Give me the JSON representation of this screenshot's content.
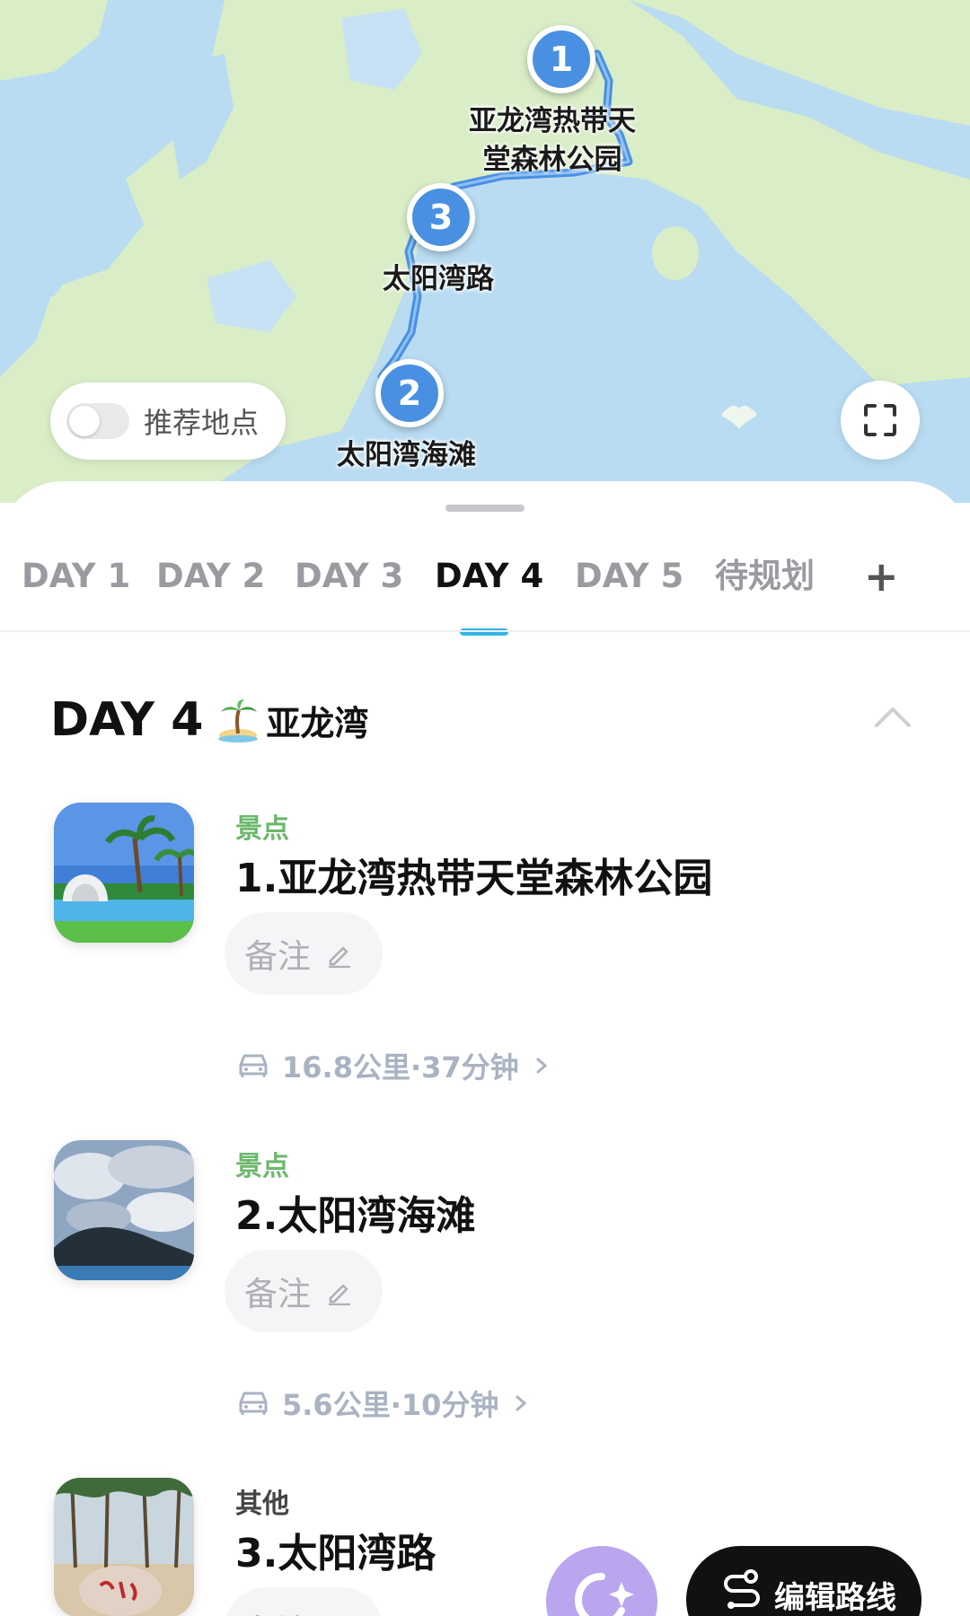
{
  "map": {
    "markers": [
      {
        "number": "1",
        "label": "亚龙湾热带天堂森林公园",
        "label_line1": "亚龙湾热带天",
        "label_line2": "堂森林公园"
      },
      {
        "number": "2",
        "label": "太阳湾海滩"
      },
      {
        "number": "3",
        "label": "太阳湾路"
      }
    ],
    "recommend_toggle": {
      "label": "推荐地点",
      "on": false
    },
    "fullscreen_icon": "fullscreen-icon",
    "colors": {
      "water": "#b9dcf2",
      "land": "#d9edc7",
      "route": "#4a90e2"
    }
  },
  "tabs": [
    {
      "label": "DAY 1"
    },
    {
      "label": "DAY 2"
    },
    {
      "label": "DAY 3"
    },
    {
      "label": "DAY 4",
      "active": true
    },
    {
      "label": "DAY 5"
    },
    {
      "label": "待规划"
    },
    {
      "label": "+"
    }
  ],
  "day": {
    "title": "DAY 4",
    "emoji": "island-icon",
    "place": "亚龙湾"
  },
  "items": [
    {
      "category": "景点",
      "name": "1.亚龙湾热带天堂森林公园",
      "note": "备注"
    },
    {
      "category": "景点",
      "name": "2.太阳湾海滩",
      "note": "备注"
    },
    {
      "category": "其他",
      "name": "3.太阳湾路",
      "note": "备注"
    }
  ],
  "transits": [
    {
      "text": "16.8公里·37分钟"
    },
    {
      "text": "5.6公里·10分钟"
    }
  ],
  "bottom": {
    "edit_route_label": "编辑路线"
  },
  "accent_colors": {
    "tab_indicator": "#33b4e6",
    "category_green": "#6cb86c"
  }
}
